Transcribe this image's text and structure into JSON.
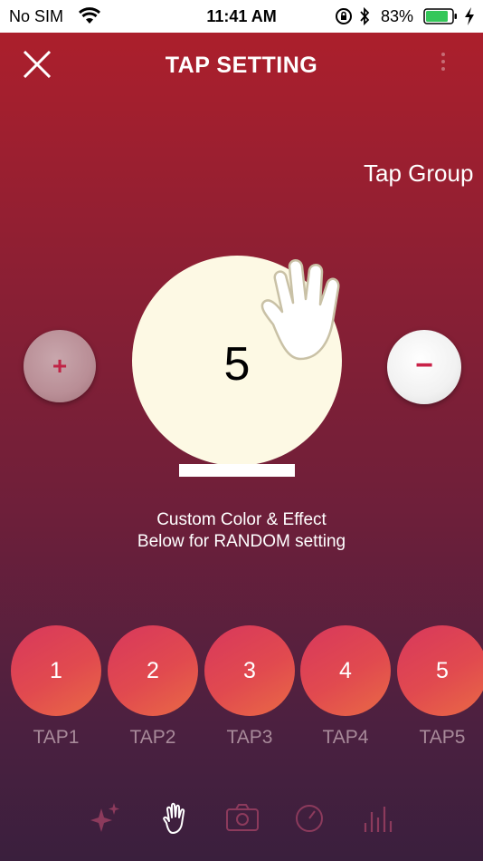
{
  "status": {
    "carrier": "No SIM",
    "time": "11:41 AM",
    "battery_pct": "83%",
    "battery_color": "#34c759"
  },
  "nav": {
    "title": "TAP SETTING",
    "close_icon": "close-icon",
    "more_icon": "more-vertical-icon"
  },
  "tap_group_label": "Tap Group",
  "controls": {
    "plus_label": "+",
    "minus_label": "−"
  },
  "tap_button": {
    "count": "5",
    "icon": "hand-icon"
  },
  "instructions": {
    "line1": "Custom Color & Effect",
    "line2": "Below for RANDOM setting"
  },
  "taps": [
    {
      "number": "1",
      "label": "TAP1"
    },
    {
      "number": "2",
      "label": "TAP2"
    },
    {
      "number": "3",
      "label": "TAP3"
    },
    {
      "number": "4",
      "label": "TAP4"
    },
    {
      "number": "5",
      "label": "TAP5"
    }
  ],
  "tabbar": [
    {
      "icon": "sparkle-icon",
      "active": false
    },
    {
      "icon": "hand-icon",
      "active": true
    },
    {
      "icon": "camera-icon",
      "active": false
    },
    {
      "icon": "speedometer-icon",
      "active": false
    },
    {
      "icon": "equalizer-icon",
      "active": false
    }
  ],
  "colors": {
    "accent": "#c92248",
    "tap_gradient_start": "#d8385c",
    "tap_gradient_end": "#e96a45",
    "circle_fill": "#fdf9e4"
  }
}
